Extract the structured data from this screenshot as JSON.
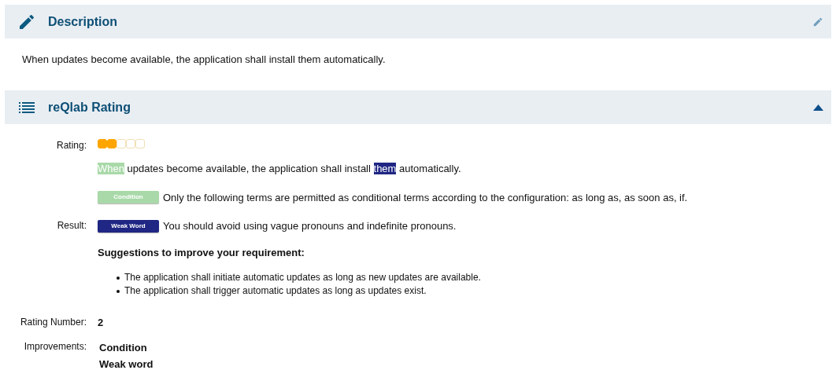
{
  "description": {
    "title": "Description",
    "text": "When updates become available, the application shall install them automatically."
  },
  "rating_panel": {
    "title": "reQlab Rating",
    "expanded": true,
    "rating": {
      "label": "Rating:",
      "stars": 2
    },
    "result": {
      "label": "Result:",
      "sentence": [
        {
          "text": "When",
          "kind": "condition"
        },
        {
          "text": " updates become available, the application shall install ",
          "kind": "plain"
        },
        {
          "text": "them",
          "kind": "weak_word"
        },
        {
          "text": " automatically.",
          "kind": "plain"
        }
      ],
      "findings": [
        {
          "tag": "Condition",
          "kind": "condition",
          "color": "#a9d9a9",
          "text": "Only the following terms are permitted as conditional terms according to the configuration: as long as, as soon as, if."
        },
        {
          "tag": "Weak Word",
          "kind": "weak_word",
          "color": "#1f2683",
          "text": "You should avoid using vague pronouns and indefinite pronouns."
        }
      ],
      "suggestions_title": "Suggestions to improve your requirement:",
      "suggestions": [
        "The application shall initiate automatic updates as long as new updates are available.",
        "The application shall trigger automatic updates as long as updates exist."
      ]
    },
    "rating_number": {
      "label": "Rating Number:",
      "value": "2"
    },
    "improvements": {
      "label": "Improvements:",
      "items": [
        "Condition",
        "Weak word"
      ]
    }
  }
}
